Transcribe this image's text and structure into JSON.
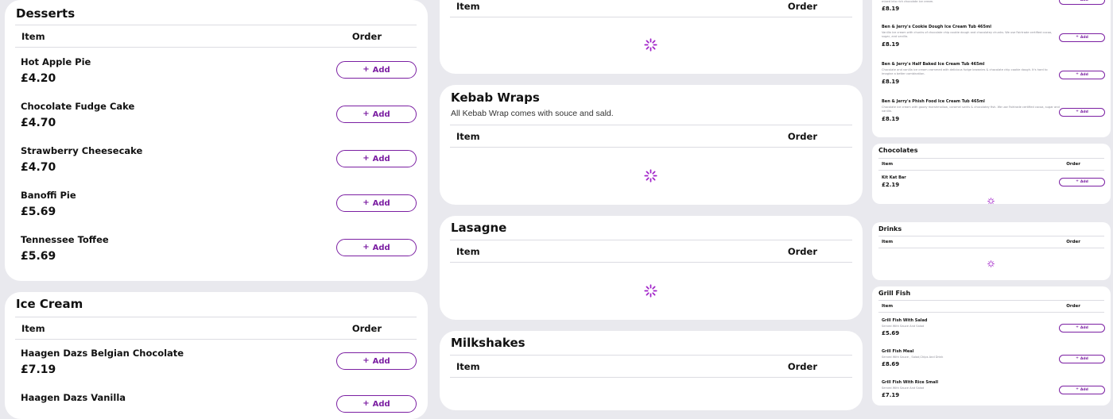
{
  "currency_symbol": "£",
  "accent_color": "#7b1fa2",
  "table_header": {
    "item": "Item",
    "order": "Order"
  },
  "add_label": "Add",
  "col1": {
    "desserts": {
      "title": "Desserts",
      "items": [
        {
          "name": "Hot Apple Pie",
          "price": "£4.20"
        },
        {
          "name": "Chocolate Fudge Cake",
          "price": "£4.70"
        },
        {
          "name": "Strawberry Cheesecake",
          "price": "£4.70"
        },
        {
          "name": "Banoffi Pie",
          "price": "£5.69"
        },
        {
          "name": "Tennessee Toffee",
          "price": "£5.69"
        }
      ]
    },
    "ice_cream": {
      "title": "Ice Cream",
      "items": [
        {
          "name": "Haagen Dazs Belgian Chocolate",
          "price": "£7.19"
        },
        {
          "name": "Haagen Dazs Vanilla",
          "price": ""
        }
      ]
    }
  },
  "col2": {
    "kebab_wraps": {
      "title": "Kebab Wraps",
      "description": "All Kebab Wrap comes with souce and sald."
    },
    "lasagne": {
      "title": "Lasagne"
    },
    "milkshakes": {
      "title": "Milkshakes"
    }
  },
  "col3": {
    "ice_cream_top": {
      "items": [
        {
          "name": "",
          "desc": "mixed into rich chocolate ice cream.",
          "price": "£8.19"
        },
        {
          "name": "Ben & Jerry's Cookie Dough Ice Cream Tub 465ml",
          "desc": "Vanilla ice cream with chunks of chocolate chip cookie dough and chocolatey chunks. We use Fairtrade certified cocoa, sugar, and vanilla.",
          "price": "£8.19"
        },
        {
          "name": "Ben & Jerry's Half Baked Ice Cream Tub 465ml",
          "desc": "Chocolate and vanilla ice cream crammed with delicious fudge brownies & chocolate chip cookie dough. It's hard to imagine a better combination.",
          "price": "£8.19"
        },
        {
          "name": "Ben & Jerry's Phish Food Ice Cream Tub 465ml",
          "desc": "Chocolate ice cream with gooey marshmallow, caramel swirls & chocolatey fish. We use Fairtrade certified cocoa, sugar and vanilla.",
          "price": "£8.19"
        }
      ]
    },
    "chocolates": {
      "title": "Chocolates",
      "items": [
        {
          "name": "Kit Kat Bar",
          "price": "£2.19"
        }
      ]
    },
    "drinks": {
      "title": "Drinks"
    },
    "grill_fish": {
      "title": "Grill Fish",
      "items": [
        {
          "name": "Grill Fish With Salad",
          "desc": "Served With Sauce And Salad",
          "price": "£5.69"
        },
        {
          "name": "Grill Fish Meal",
          "desc": "Served With Sauce , Salad,Chips And Drink",
          "price": "£8.69"
        },
        {
          "name": "Grill Fish With Rice Small",
          "desc": "Served With Sauce And Salad",
          "price": "£7.19"
        }
      ]
    }
  }
}
